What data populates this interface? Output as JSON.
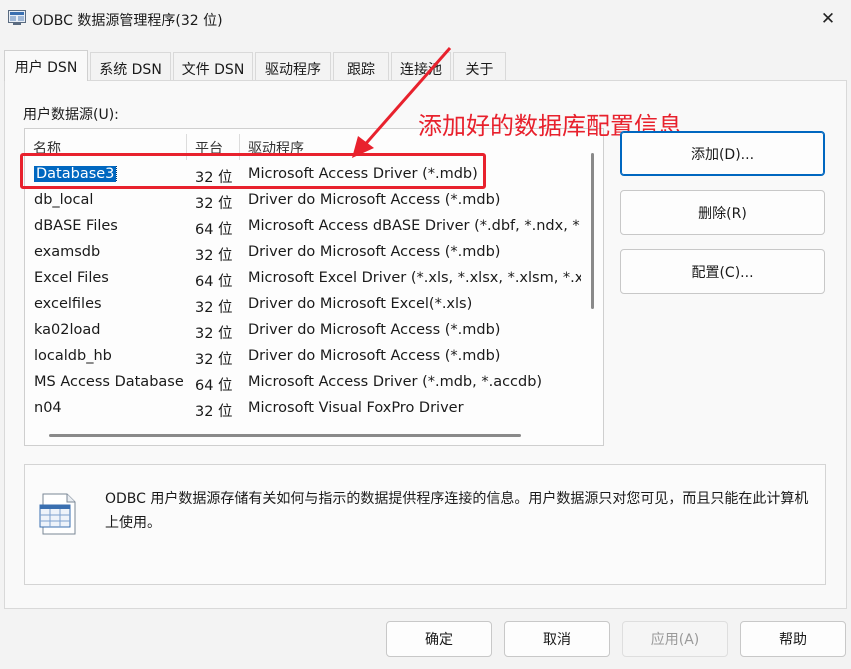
{
  "window": {
    "title": "ODBC 数据源管理程序(32 位)",
    "close_glyph": "✕"
  },
  "tabs": [
    {
      "label": "用户 DSN",
      "active": true
    },
    {
      "label": "系统 DSN"
    },
    {
      "label": "文件 DSN"
    },
    {
      "label": "驱动程序"
    },
    {
      "label": "跟踪"
    },
    {
      "label": "连接池"
    },
    {
      "label": "关于"
    }
  ],
  "list": {
    "label": "用户数据源(U):",
    "columns": [
      "名称",
      "平台",
      "驱动程序"
    ],
    "rows": [
      {
        "name": "Database3",
        "platform": "32 位",
        "driver": "Microsoft Access Driver (*.mdb)",
        "selected": true
      },
      {
        "name": "db_local",
        "platform": "32 位",
        "driver": "Driver do Microsoft Access (*.mdb)"
      },
      {
        "name": "dBASE Files",
        "platform": "64 位",
        "driver": "Microsoft Access dBASE Driver (*.dbf, *.ndx, *."
      },
      {
        "name": "examsdb",
        "platform": "32 位",
        "driver": "Driver do Microsoft Access (*.mdb)"
      },
      {
        "name": "Excel Files",
        "platform": "64 位",
        "driver": "Microsoft Excel Driver (*.xls, *.xlsx, *.xlsm, *.xls"
      },
      {
        "name": "excelfiles",
        "platform": "32 位",
        "driver": "Driver do Microsoft Excel(*.xls)"
      },
      {
        "name": "ka02load",
        "platform": "32 位",
        "driver": "Driver do Microsoft Access (*.mdb)"
      },
      {
        "name": "localdb_hb",
        "platform": "32 位",
        "driver": "Driver do Microsoft Access (*.mdb)"
      },
      {
        "name": "MS Access Database",
        "platform": "64 位",
        "driver": "Microsoft Access Driver (*.mdb, *.accdb)"
      },
      {
        "name": "n04",
        "platform": "32 位",
        "driver": "Microsoft Visual FoxPro Driver"
      }
    ]
  },
  "annotation": {
    "text": "添加好的数据库配置信息",
    "color": "#e8212d"
  },
  "side_buttons": {
    "add": "添加(D)...",
    "remove": "删除(R)",
    "configure": "配置(C)..."
  },
  "info": {
    "text": "ODBC 用户数据源存储有关如何与指示的数据提供程序连接的信息。用户数据源只对您可见，而且只能在此计算机上使用。"
  },
  "bottom_buttons": {
    "ok": "确定",
    "cancel": "取消",
    "apply": "应用(A)",
    "help": "帮助"
  },
  "colors": {
    "selection": "#0067c0",
    "accent": "#0067c0",
    "annotation": "#e8212d"
  }
}
